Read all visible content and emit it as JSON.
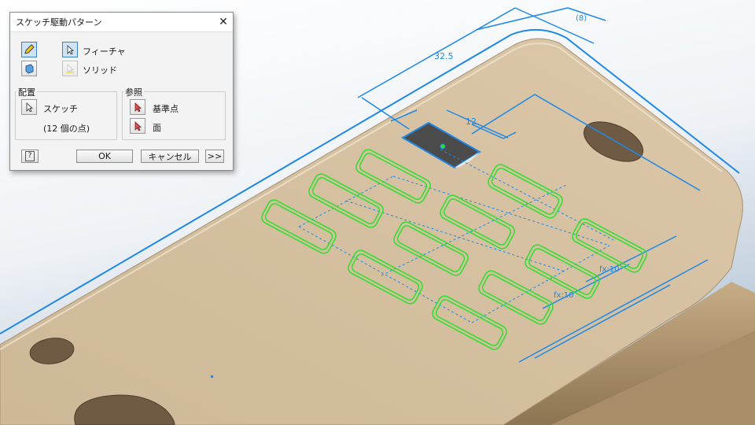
{
  "dialog": {
    "title": "スケッチ駆動パターン",
    "close_glyph": "✕",
    "options": {
      "feature_label": "フィーチャ",
      "solid_label": "ソリッド"
    },
    "placement": {
      "title": "配置",
      "sketch_label": "スケッチ",
      "point_count": "(12 個の点)"
    },
    "reference": {
      "title": "参照",
      "base_point_label": "基準点",
      "face_label": "面"
    },
    "buttons": {
      "help_glyph": "?",
      "ok": "OK",
      "cancel": "キャンセル",
      "more": ">>"
    }
  },
  "viewport": {
    "dimensions": {
      "d1": "32.5",
      "d2": "(8)",
      "d3": "12",
      "fx1": "fx:10",
      "fx2": "fx:10"
    },
    "colors": {
      "background_top": "#ffffff",
      "background_bottom": "#b9c8d8",
      "part": "#d8c3a2",
      "sketch": "#2ee02e",
      "dimension": "#1e88e8"
    }
  }
}
